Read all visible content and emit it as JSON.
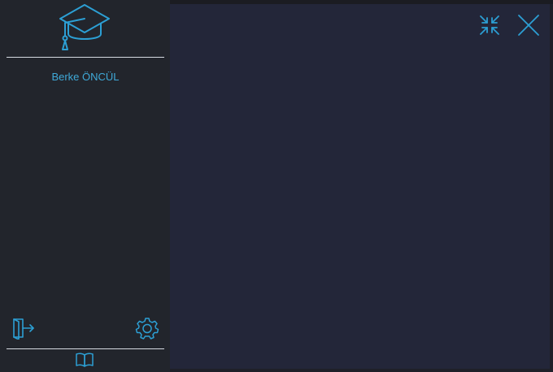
{
  "user": {
    "name": "Berke ÖNCÜL"
  },
  "icons": {
    "logo": "graduation-cap-icon",
    "logout": "door-exit-icon",
    "settings": "gear-icon",
    "book": "open-book-icon",
    "minimize": "arrows-collapse-icon",
    "close": "close-icon"
  },
  "colors": {
    "accent": "#2c9fd4",
    "sidebar_bg": "#22252c",
    "main_bg": "#232639",
    "username_text": "#3fa9d8",
    "divider": "#d7dbe2"
  }
}
